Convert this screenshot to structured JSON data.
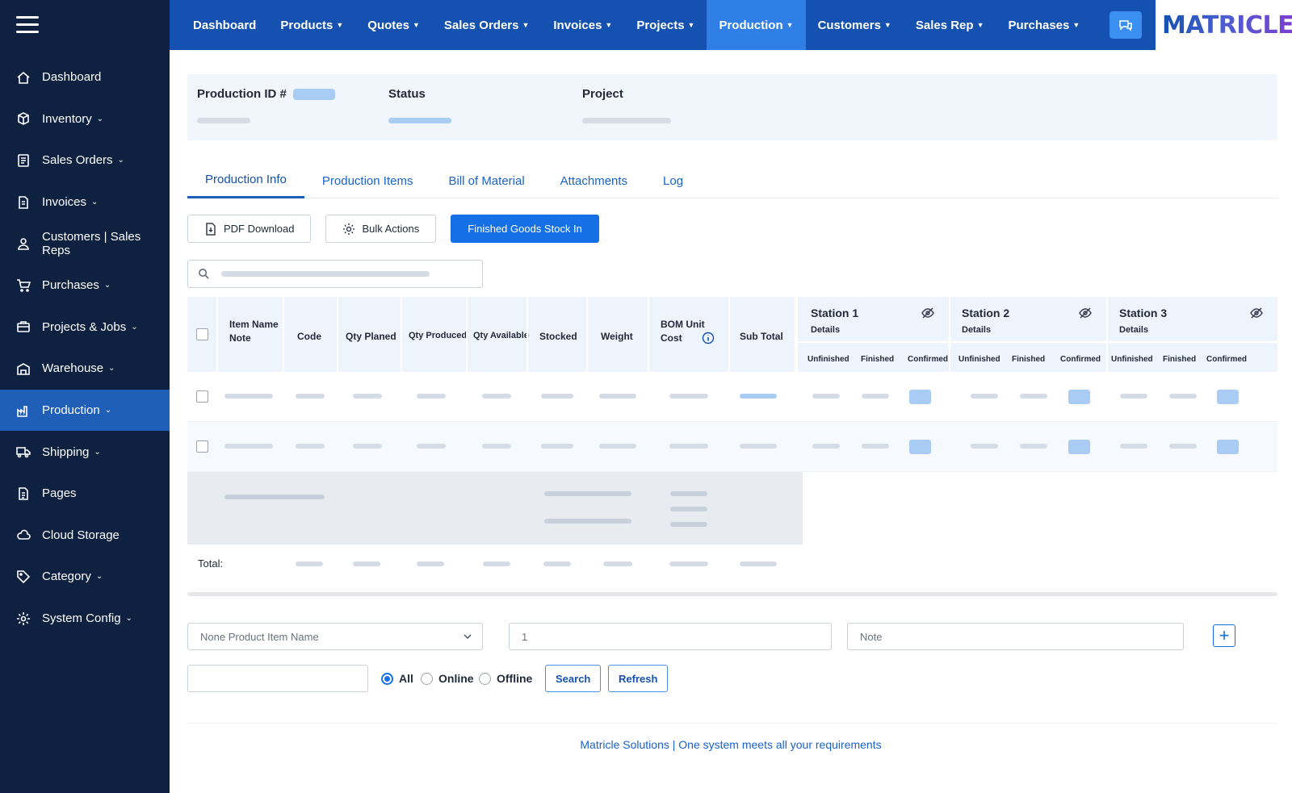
{
  "sidebar": {
    "items": [
      {
        "label": "Dashboard",
        "icon": "home-icon",
        "chevron": false
      },
      {
        "label": "Inventory",
        "icon": "box-icon",
        "chevron": true
      },
      {
        "label": "Sales Orders",
        "icon": "list-icon",
        "chevron": true
      },
      {
        "label": "Invoices",
        "icon": "document-icon",
        "chevron": true
      },
      {
        "label": "Customers | Sales Reps",
        "icon": "user-icon",
        "chevron": false
      },
      {
        "label": "Purchases",
        "icon": "cart-icon",
        "chevron": true
      },
      {
        "label": "Projects & Jobs",
        "icon": "briefcase-icon",
        "chevron": true
      },
      {
        "label": "Warehouse",
        "icon": "warehouse-icon",
        "chevron": true
      },
      {
        "label": "Production",
        "icon": "factory-icon",
        "chevron": true,
        "active": true
      },
      {
        "label": "Shipping",
        "icon": "truck-icon",
        "chevron": true
      },
      {
        "label": "Pages",
        "icon": "page-icon",
        "chevron": false
      },
      {
        "label": "Cloud Storage",
        "icon": "cloud-icon",
        "chevron": false
      },
      {
        "label": "Category",
        "icon": "tag-icon",
        "chevron": true
      },
      {
        "label": "System Config",
        "icon": "gear-icon",
        "chevron": true
      }
    ]
  },
  "topnav": {
    "items": [
      {
        "label": "Dashboard",
        "caret": false
      },
      {
        "label": "Products",
        "caret": true
      },
      {
        "label": "Quotes",
        "caret": true
      },
      {
        "label": "Sales Orders",
        "caret": true
      },
      {
        "label": "Invoices",
        "caret": true
      },
      {
        "label": "Projects",
        "caret": true
      },
      {
        "label": "Production",
        "caret": true,
        "active": true
      },
      {
        "label": "Customers",
        "caret": true
      },
      {
        "label": "Sales Rep",
        "caret": true
      },
      {
        "label": "Purchases",
        "caret": true
      }
    ],
    "logo": "MATRICLE"
  },
  "header": {
    "production_id_label": "Production ID #",
    "status_label": "Status",
    "project_label": "Project"
  },
  "tabs": [
    "Production Info",
    "Production Items",
    "Bill of Material",
    "Attachments",
    "Log"
  ],
  "actions": {
    "pdf": "PDF Download",
    "bulk": "Bulk Actions",
    "stock_in": "Finished Goods Stock In"
  },
  "table": {
    "columns": {
      "item_name": "Item Name",
      "note": "Note",
      "code": "Code",
      "qty_planed": "Qty Planed",
      "qty_produced": "Qty Produced",
      "qty_available": "Qty Available",
      "stocked": "Stocked",
      "weight": "Weight",
      "bom_unit": "BOM Unit",
      "cost": "Cost",
      "sub_total": "Sub Total"
    },
    "stations": [
      {
        "name": "Station 1",
        "sub": "Details"
      },
      {
        "name": "Station 2",
        "sub": "Details"
      },
      {
        "name": "Station 3",
        "sub": "Details"
      }
    ],
    "station_cols": [
      "Unfinished",
      "Finished",
      "Confirmed"
    ],
    "total_label": "Total:"
  },
  "add_item": {
    "select_placeholder": "None Product Item Name",
    "qty_value": "1",
    "note_placeholder": "Note"
  },
  "filters": {
    "all": "All",
    "online": "Online",
    "offline": "Offline",
    "selected": "All",
    "search": "Search",
    "refresh": "Refresh"
  },
  "footer": "Matricle Solutions | One system meets all your requirements"
}
